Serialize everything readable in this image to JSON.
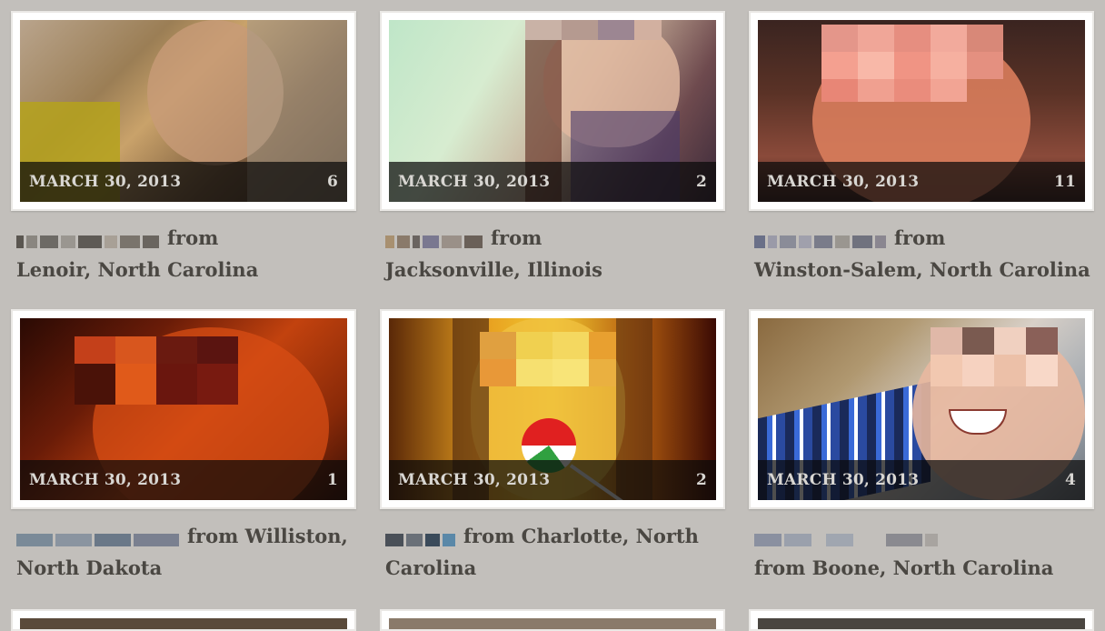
{
  "cards": [
    {
      "date": "MARCH 30, 2013",
      "count": "6",
      "from_text": "from",
      "location": "Lenoir, North Carolina",
      "photo_alt": "selfie-photo"
    },
    {
      "date": "MARCH 30, 2013",
      "count": "2",
      "from_text": "from",
      "location": "Jacksonville, Illinois",
      "photo_alt": "selfie-photo"
    },
    {
      "date": "MARCH 30, 2013",
      "count": "11",
      "from_text": "from",
      "location": "Winston-Salem, North Carolina",
      "photo_alt": "selfie-photo"
    },
    {
      "date": "MARCH 30, 2013",
      "count": "1",
      "from_text": "from Williston,",
      "location": "North Dakota",
      "photo_alt": "selfie-photo"
    },
    {
      "date": "MARCH 30, 2013",
      "count": "2",
      "from_text": "from Charlotte, North",
      "location": "Carolina",
      "photo_alt": "selfie-photo"
    },
    {
      "date": "MARCH 30, 2013",
      "count": "4",
      "from_text": "",
      "location": "from Boone, North Carolina",
      "photo_alt": "selfie-photo"
    }
  ],
  "colors": {
    "background": "#c2bfbb",
    "caption_bar": "#0a0a0a",
    "text": "#4a4742"
  }
}
